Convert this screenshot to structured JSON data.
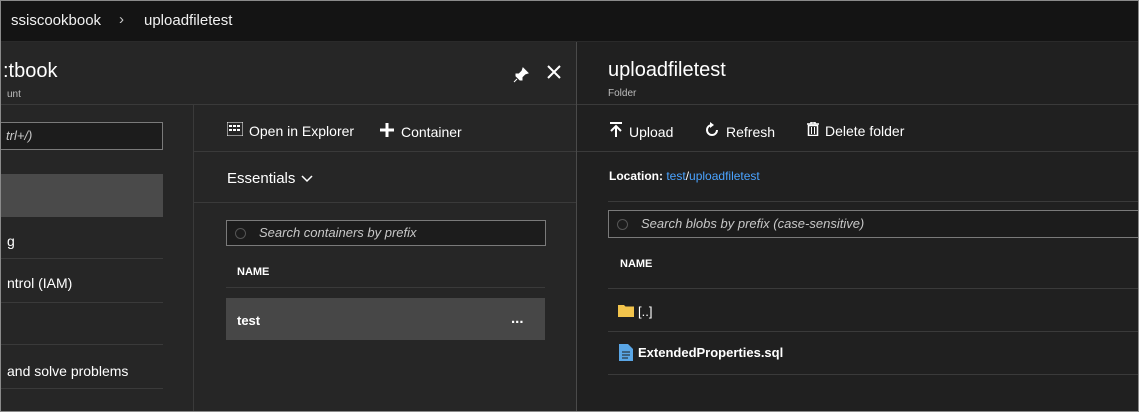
{
  "breadcrumb": {
    "items": [
      "ssiscookbook",
      "uploadfiletest"
    ],
    "separator": "›"
  },
  "left_blade": {
    "title": ":tbook",
    "subtitle": "unt",
    "search_placeholder": "trl+/)",
    "menu_items": [
      "g",
      "ntrol (IAM)",
      "and solve problems"
    ],
    "pin_icon": "pin-icon",
    "close_icon": "close-icon"
  },
  "containers_blade": {
    "toolbar": {
      "open_in_explorer": "Open in Explorer",
      "container": "Container"
    },
    "essentials_label": "Essentials",
    "search_placeholder": "Search containers by prefix",
    "column_name": "NAME",
    "rows": [
      {
        "name": "test",
        "more": "..."
      }
    ]
  },
  "folder_blade": {
    "title": "uploadfiletest",
    "subtitle": "Folder",
    "toolbar": {
      "upload": "Upload",
      "refresh": "Refresh",
      "delete_folder": "Delete folder"
    },
    "location_label": "Location:",
    "location_path": [
      "test",
      "uploadfiletest"
    ],
    "location_sep": "/",
    "search_placeholder": "Search blobs by prefix (case-sensitive)",
    "column_name": "NAME",
    "rows": [
      {
        "name": "[..]",
        "icon": "folder-icon"
      },
      {
        "name": "ExtendedProperties.sql",
        "icon": "file-icon"
      }
    ]
  },
  "colors": {
    "background": "#1f1f1f",
    "selected": "#474747",
    "link": "#4aa3ff",
    "folder": "#f2c44c",
    "file": "#5aa6e6"
  }
}
